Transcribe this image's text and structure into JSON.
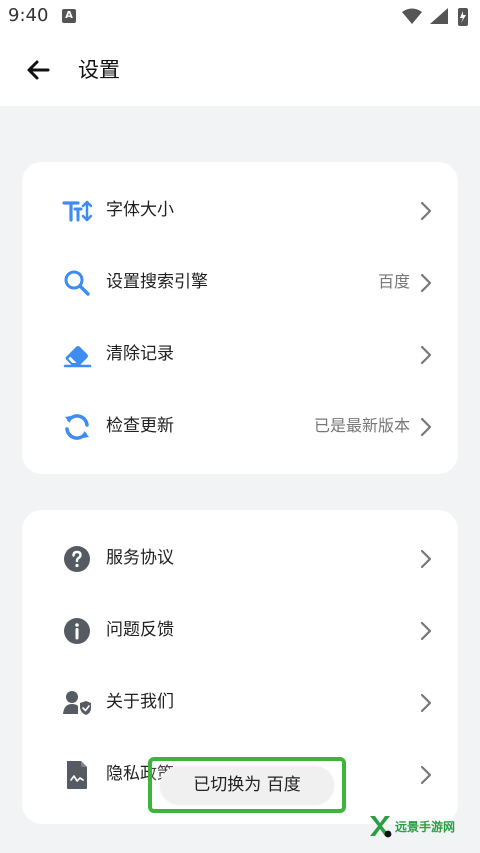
{
  "status_bar": {
    "time": "9:40",
    "notification_icon": "A",
    "icons": [
      "wifi-icon",
      "signal-icon",
      "battery-icon"
    ]
  },
  "header": {
    "title": "设置",
    "back_icon": "arrow-left-icon"
  },
  "settings_group_1": [
    {
      "label": "字体大小",
      "value": "",
      "icon": "font-size-icon",
      "color": "#3f8cf0"
    },
    {
      "label": "设置搜索引擎",
      "value": "百度",
      "icon": "search-icon",
      "color": "#3f8cf0"
    },
    {
      "label": "清除记录",
      "value": "",
      "icon": "eraser-icon",
      "color": "#3f8cf0"
    },
    {
      "label": "检查更新",
      "value": "已是最新版本",
      "icon": "refresh-icon",
      "color": "#3f8cf0"
    }
  ],
  "settings_group_2": [
    {
      "label": "服务协议",
      "value": "",
      "icon": "question-circle-icon",
      "color": "#555a63"
    },
    {
      "label": "问题反馈",
      "value": "",
      "icon": "info-circle-icon",
      "color": "#555a63"
    },
    {
      "label": "关于我们",
      "value": "",
      "icon": "user-shield-icon",
      "color": "#555a63"
    },
    {
      "label": "隐私政策",
      "value": "",
      "icon": "document-icon",
      "color": "#555a63"
    }
  ],
  "toast": {
    "text": "已切换为 百度"
  },
  "watermark": {
    "text": "远景手游网"
  },
  "colors": {
    "accent": "#3f8cf0",
    "background": "#f2f3f5",
    "card": "#ffffff",
    "toast_outline": "#3db53b"
  }
}
